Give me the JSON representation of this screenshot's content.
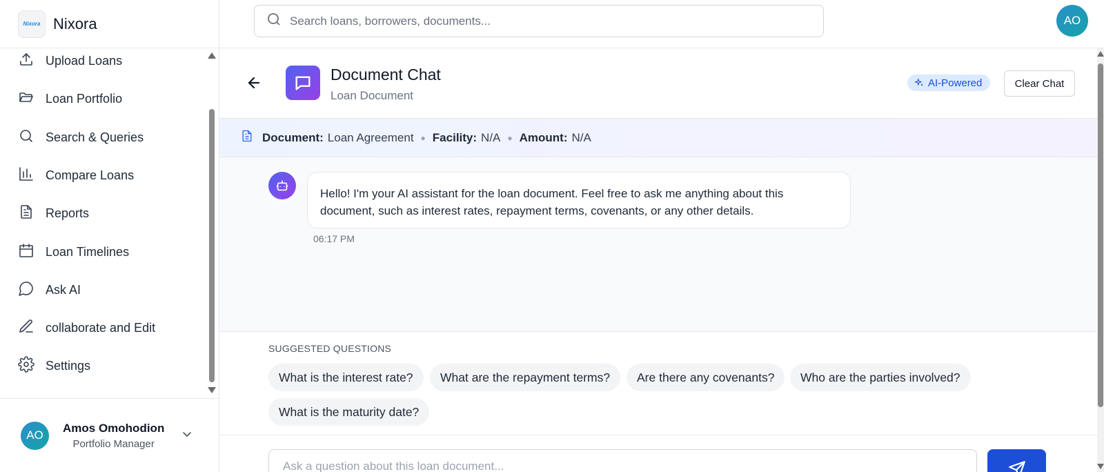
{
  "brand": {
    "name": "Nixora",
    "logo_text": "Nixora"
  },
  "search": {
    "placeholder": "Search loans, borrowers, documents..."
  },
  "top_avatar": "AO",
  "sidebar": {
    "items": [
      {
        "label": "Upload Loans",
        "icon": "upload-icon"
      },
      {
        "label": "Loan Portfolio",
        "icon": "folder-icon"
      },
      {
        "label": "Search & Queries",
        "icon": "search-icon"
      },
      {
        "label": "Compare Loans",
        "icon": "bar-chart-icon"
      },
      {
        "label": "Reports",
        "icon": "document-icon"
      },
      {
        "label": "Loan Timelines",
        "icon": "calendar-icon"
      },
      {
        "label": "Ask AI",
        "icon": "message-circle-icon"
      },
      {
        "label": "collaborate and Edit",
        "icon": "pen-icon"
      },
      {
        "label": "Settings",
        "icon": "gear-icon"
      }
    ],
    "user": {
      "initials": "AO",
      "name": "Amos Omohodion",
      "role": "Portfolio Manager"
    }
  },
  "chat": {
    "title": "Document Chat",
    "subtitle": "Loan Document",
    "badge": "AI-Powered",
    "clear_label": "Clear Chat"
  },
  "doc_bar": {
    "document_key": "Document:",
    "document_value": "Loan Agreement",
    "facility_key": "Facility:",
    "facility_value": "N/A",
    "amount_key": "Amount:",
    "amount_value": "N/A"
  },
  "messages": [
    {
      "text": "Hello! I'm your AI assistant for the loan document. Feel free to ask me anything about this document, such as interest rates, repayment terms, covenants, or any other details.",
      "time": "06:17 PM"
    }
  ],
  "suggestions": {
    "label": "SUGGESTED QUESTIONS",
    "items": [
      "What is the interest rate?",
      "What are the repayment terms?",
      "Are there any covenants?",
      "Who are the parties involved?",
      "What is the maturity date?"
    ]
  },
  "composer": {
    "placeholder": "Ask a question about this loan document..."
  },
  "colors": {
    "accent": "#1d4ed8",
    "gradient_start": "#4f63f0",
    "gradient_end": "#9b3fe6",
    "avatar": "#2a8fc9"
  }
}
